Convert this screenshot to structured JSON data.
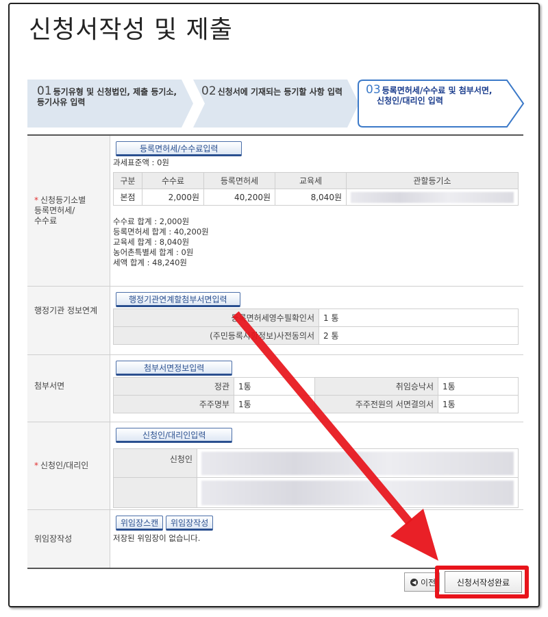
{
  "page": {
    "title": "신청서작성 및 제출"
  },
  "steps": [
    {
      "num": "01",
      "line1": "등기유형 및 신청법인, 제출 등기소,",
      "line2": "등기사유 입력",
      "active": false
    },
    {
      "num": "02",
      "line1": "신청서에 기재되는 등기할 사항 입력",
      "line2": "",
      "active": false
    },
    {
      "num": "03",
      "line1": "등록면허세/수수료 및 첨부서면,",
      "line2": "신청인/대리인 입력",
      "active": true
    }
  ],
  "fees": {
    "label_line1": "신청등기소별",
    "label_line2": "등록면허세/",
    "label_line3": "수수료",
    "required_mark": "*",
    "button": "등록면허세/수수료입력",
    "tax_base": "과세표준액 : 0원",
    "table": {
      "headers": [
        "구분",
        "수수료",
        "등록면허세",
        "교육세",
        "관할등기소"
      ],
      "rows": [
        {
          "type": "본점",
          "fee": "2,000원",
          "reg_tax": "40,200원",
          "edu_tax": "8,040원",
          "office": ""
        }
      ]
    },
    "summary": [
      "수수료 합계 : 2,000원",
      "등록면허세 합계 : 40,200원",
      "교육세 합계 : 8,040원",
      "농어촌특별세 합계 : 0원",
      "세액 합계 : 48,240원"
    ]
  },
  "admin": {
    "label": "행정기관 정보연계",
    "button": "행정기관연계할첨부서면입력",
    "rows": [
      {
        "name": "등록면허세영수필확인서",
        "count": "1 통"
      },
      {
        "name": "(주민등록사항정보)사전동의서",
        "count": "2 통"
      }
    ]
  },
  "attachments": {
    "label": "첨부서면",
    "button": "첨부서면정보입력",
    "rows": [
      {
        "name1": "정관",
        "count1": "1통",
        "name2": "취임승낙서",
        "count2": "1통"
      },
      {
        "name1": "주주명부",
        "count1": "1통",
        "name2": "주주전원의 서면결의서",
        "count2": "1통"
      }
    ]
  },
  "applicant": {
    "label": "신청인/대리인",
    "required_mark": "*",
    "button": "신청인/대리인입력",
    "row_label": "신청인"
  },
  "poa": {
    "label": "위임장작성",
    "btn_scan": "위임장스캔",
    "btn_write": "위임장작성",
    "message": "저장된 위임장이 없습니다."
  },
  "footer": {
    "prev_label": "이전",
    "complete_label": "신청서작성완료"
  },
  "colors": {
    "highlight": "#e8141b",
    "step_bg": "#dde6f0",
    "active_step_border": "#3b79c8"
  }
}
